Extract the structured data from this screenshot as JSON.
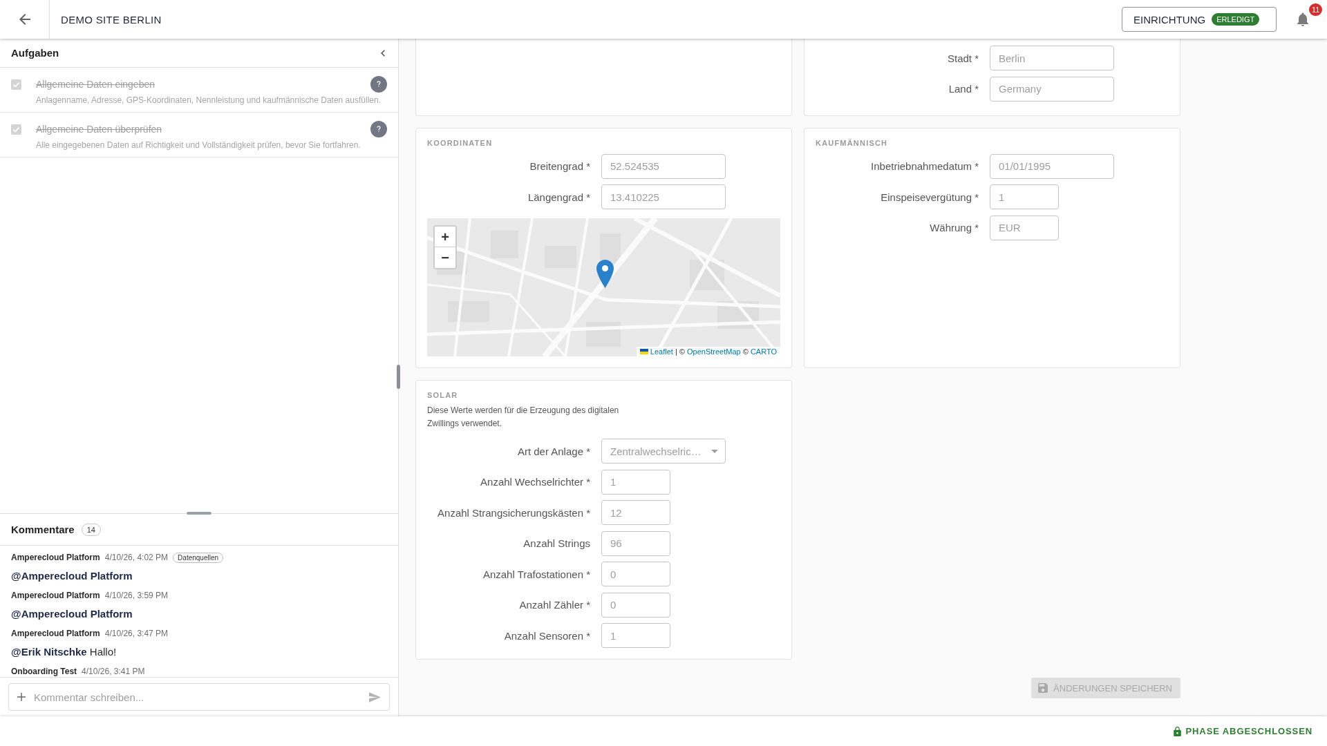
{
  "header": {
    "title": "DEMO SITE BERLIN",
    "phase": {
      "label": "EINRICHTUNG",
      "status": "ERLEDIGT"
    },
    "notifications": {
      "count": "11"
    }
  },
  "tasks_panel": {
    "title": "Aufgaben",
    "tasks": [
      {
        "title": "Allgemeine Daten eingeben",
        "description": "Anlagenname, Adresse, GPS-Koordinaten, Nennleistung und kaufmännische Daten ausfüllen.",
        "checked": true
      },
      {
        "title": "Allgemeine Daten überprüfen",
        "description": "Alle eingegebenen Daten auf Richtigkeit und Vollständigkeit prüfen, bevor Sie fortfahren.",
        "checked": true
      }
    ]
  },
  "comments": {
    "title": "Kommentare",
    "count": "14",
    "items": [
      {
        "author": "Amperecloud Platform",
        "time": "4/10/26, 4:02 PM",
        "tag": "Datenquellen",
        "mention": "@Amperecloud Platform"
      },
      {
        "author": "Amperecloud Platform",
        "time": "4/10/26, 3:59 PM",
        "mention": "@Amperecloud Platform"
      },
      {
        "author": "Amperecloud Platform",
        "time": "4/10/26, 3:47 PM",
        "mention": "@Erik Nitschke",
        "text": "Hallo!"
      },
      {
        "author": "Onboarding Test",
        "time": "4/10/26, 3:41 PM"
      }
    ],
    "input": {
      "placeholder": "Kommentar schreiben..."
    }
  },
  "form": {
    "disabled": true,
    "sections": [
      {
        "kind": "partial"
      },
      {
        "kind": "partial",
        "fields": [
          {
            "label": "Stadt *",
            "value": "Berlin",
            "kind": "wide"
          },
          {
            "label": "Land *",
            "value": "Germany",
            "kind": "wide"
          }
        ]
      },
      {
        "kind": "full",
        "title": "KOORDINATEN",
        "fields": [
          {
            "label": "Breitengrad *",
            "value": "52.524535",
            "kind": "wide"
          },
          {
            "label": "Längengrad *",
            "value": "13.410225",
            "kind": "wide"
          }
        ],
        "map": {
          "zoom_in": "+",
          "zoom_out": "−",
          "attribution": [
            {
              "kind": "link",
              "text": "Leaflet"
            },
            {
              "kind": "text",
              "text": "| ©"
            },
            {
              "kind": "link",
              "text": "OpenStreetMap"
            },
            {
              "kind": "text",
              "text": "©"
            },
            {
              "kind": "link",
              "text": "CARTO"
            }
          ]
        }
      },
      {
        "kind": "full",
        "title": "KAUFMÄNNISCH",
        "fields": [
          {
            "label": "Inbetriebnahmedatum *",
            "value": "01/01/1995",
            "kind": "wide"
          },
          {
            "label": "Einspeisevergütung *",
            "value": "1",
            "kind": "narrow"
          },
          {
            "label": "Währung *",
            "value": "EUR",
            "kind": "narrow"
          }
        ]
      },
      {
        "kind": "full",
        "title": "SOLAR",
        "description": "Diese Werte werden für die Erzeugung des digitalen Zwillings verwendet.",
        "fields": [
          {
            "label": "Art der Anlage *",
            "value": "Zentralwechselric…",
            "kind": "select"
          },
          {
            "label": "Anzahl Wechselrichter *",
            "value": "1",
            "kind": "narrow"
          },
          {
            "label": "Anzahl Strangsicherungskästen *",
            "value": "12",
            "kind": "narrow"
          },
          {
            "label": "Anzahl Strings",
            "value": "96",
            "kind": "narrow"
          },
          {
            "label": "Anzahl Trafostationen *",
            "value": "0",
            "kind": "narrow"
          },
          {
            "label": "Anzahl Zähler *",
            "value": "0",
            "kind": "narrow"
          },
          {
            "label": "Anzahl Sensoren *",
            "value": "1",
            "kind": "narrow"
          }
        ]
      }
    ],
    "save_button": {
      "label": "ÄNDERUNGEN SPEICHERN",
      "disabled": true
    }
  },
  "footer": {
    "status": "PHASE ABGESCHLOSSEN"
  }
}
